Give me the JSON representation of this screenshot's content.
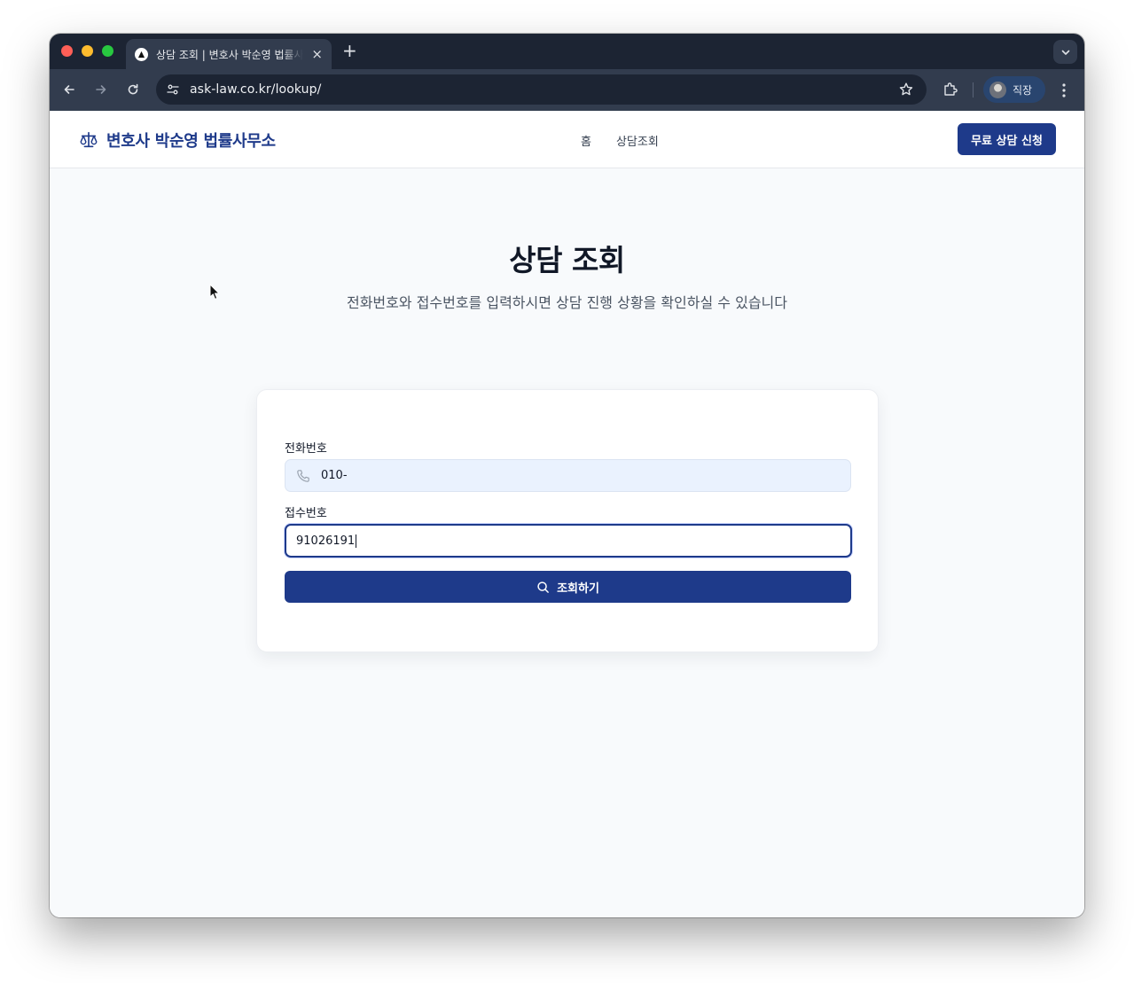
{
  "browser": {
    "tab_title": "상담 조회 | 변호사 박순영 법률사무소",
    "tab_close": "×",
    "new_tab": "+",
    "url": "ask-law.co.kr/lookup/",
    "profile_name": "직장"
  },
  "site": {
    "brand_name": "변호사 박순영 법률사무소",
    "nav": [
      {
        "label": "홈"
      },
      {
        "label": "상담조회"
      }
    ],
    "cta_label": "무료 상담 신청"
  },
  "main": {
    "title": "상담 조회",
    "subtitle": "전화번호와 접수번호를 입력하시면 상담 진행 상황을 확인하실 수 있습니다"
  },
  "form": {
    "phone_label": "전화번호",
    "phone_value": "010-",
    "receipt_label": "접수번호",
    "receipt_value": "91026191",
    "submit_label": "조회하기"
  },
  "colors": {
    "brand": "#1e3a8a",
    "tabstrip": "#1c2433",
    "toolbar": "#323c4e",
    "page_bg": "#f8fafc"
  }
}
